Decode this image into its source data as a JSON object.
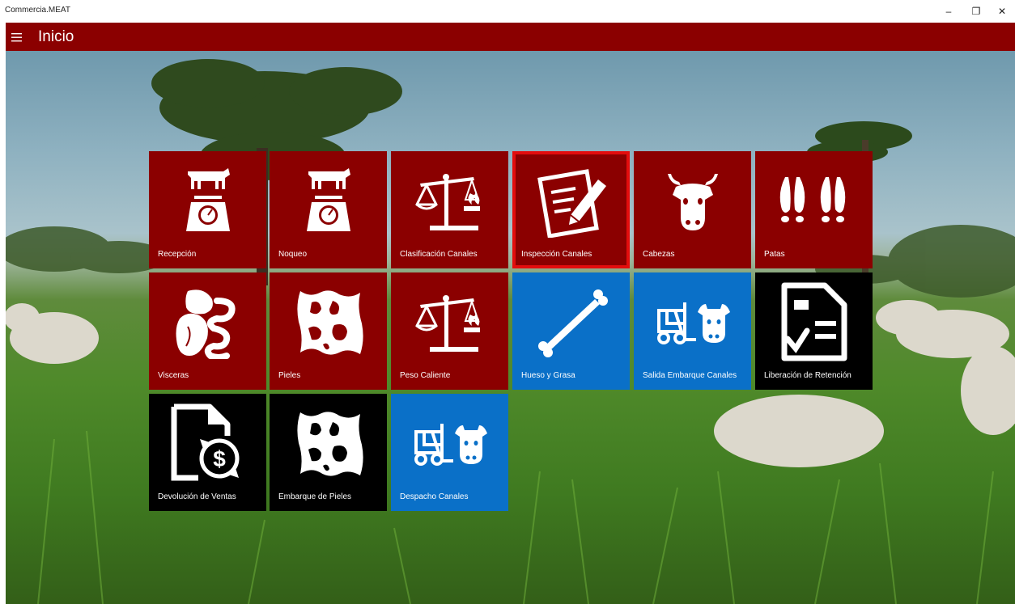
{
  "window": {
    "app_title": "Commercia.MEAT",
    "minimize_glyph": "–",
    "maximize_glyph": "❐",
    "close_glyph": "✕"
  },
  "header": {
    "title": "Inicio",
    "menu_icon": "hamburger-icon",
    "background": "#8b0000"
  },
  "colors": {
    "red_tile": "#8b0000",
    "blue_tile": "#0a70c8",
    "black_tile": "#000000",
    "selection": "#e30d0d"
  },
  "tiles": [
    {
      "label": "Recepción",
      "color": "red",
      "icon": "cow-scale-icon"
    },
    {
      "label": "Noqueo",
      "color": "red",
      "icon": "cow-scale-icon"
    },
    {
      "label": "Clasificación Canales",
      "color": "red",
      "icon": "balance-fire-icon"
    },
    {
      "label": "Inspección Canales",
      "color": "red",
      "icon": "inspection-pencil-icon",
      "selected": true
    },
    {
      "label": "Cabezas",
      "color": "red",
      "icon": "cow-head-icon"
    },
    {
      "label": "Patas",
      "color": "red",
      "icon": "hooves-icon"
    },
    {
      "label": "Visceras",
      "color": "red",
      "icon": "viscera-icon"
    },
    {
      "label": "Pieles",
      "color": "red",
      "icon": "hide-icon"
    },
    {
      "label": "Peso Caliente",
      "color": "red",
      "icon": "balance-fire-icon"
    },
    {
      "label": "Hueso y Grasa",
      "color": "blue",
      "icon": "bone-icon"
    },
    {
      "label": "Salida Embarque Canales",
      "color": "blue",
      "icon": "forklift-cow-icon"
    },
    {
      "label": "Liberación de Retención",
      "color": "black",
      "icon": "document-check-icon"
    },
    {
      "label": "Devolución de Ventas",
      "color": "black",
      "icon": "document-refund-icon"
    },
    {
      "label": "Embarque de Pieles",
      "color": "black",
      "icon": "hide-icon"
    },
    {
      "label": "Despacho Canales",
      "color": "blue",
      "icon": "forklift-cow-icon"
    }
  ]
}
